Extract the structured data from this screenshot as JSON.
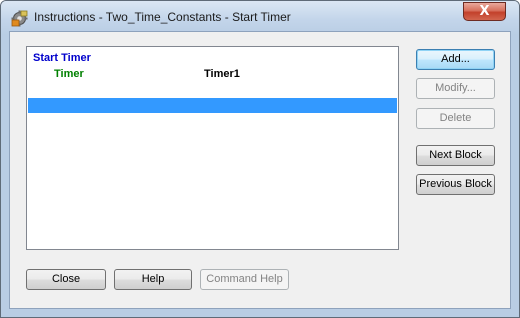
{
  "window": {
    "title": "Instructions - Two_Time_Constants - Start Timer",
    "close_symbol": "X",
    "icon": "gear-app-icon"
  },
  "list": {
    "header": "Start Timer",
    "params": [
      {
        "name": "Timer",
        "value": "Timer1"
      }
    ],
    "selected_row_color": "#3399ff",
    "header_color": "#0000cc",
    "param_name_color": "#008000"
  },
  "side_buttons": {
    "add": "Add...",
    "modify": "Modify...",
    "delete": "Delete",
    "next_block": "Next Block",
    "previous_block": "Previous Block"
  },
  "bottom_buttons": {
    "close": "Close",
    "help": "Help",
    "command_help": "Command Help"
  },
  "states": {
    "modify_enabled": false,
    "delete_enabled": false,
    "command_help_enabled": false
  }
}
